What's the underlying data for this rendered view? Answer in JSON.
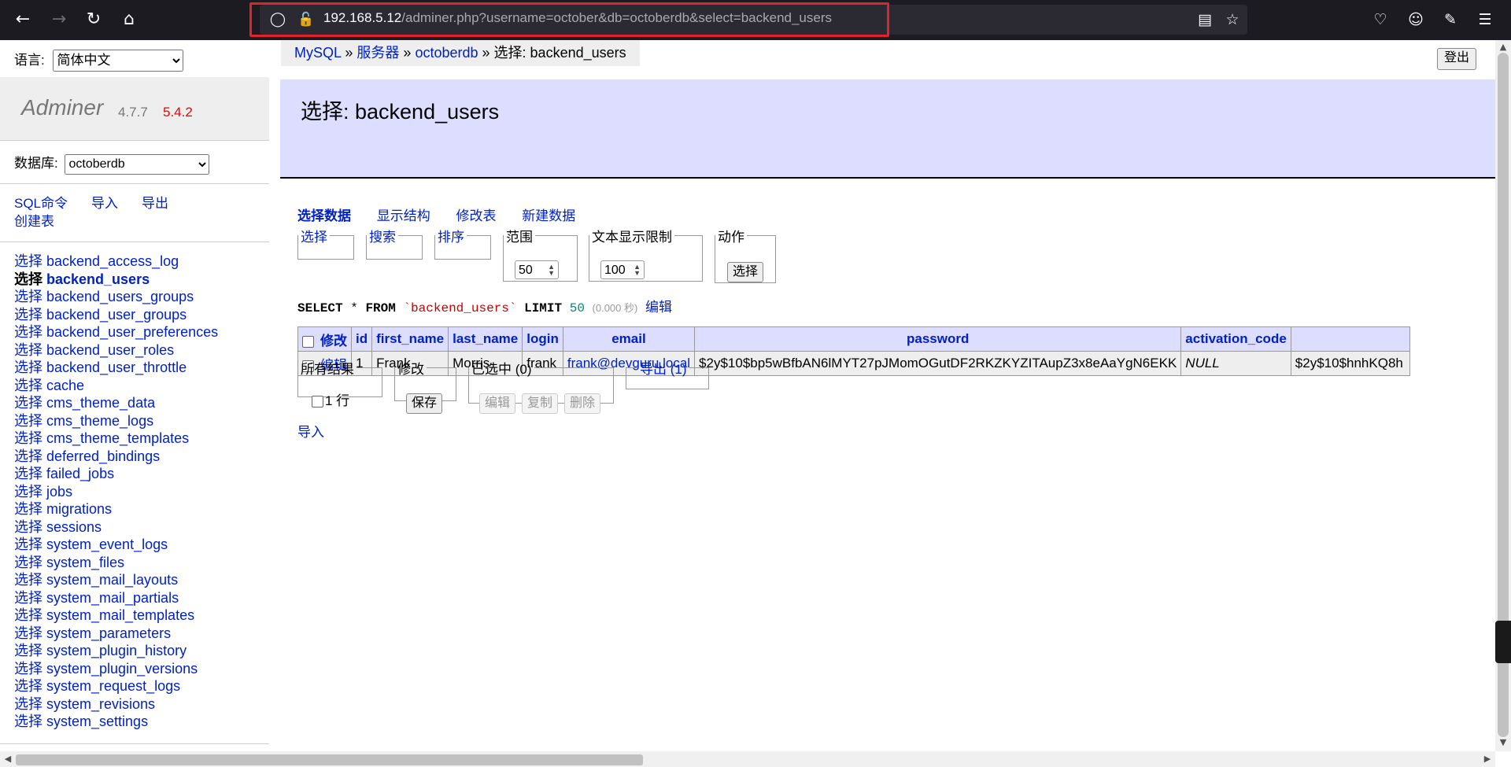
{
  "browser": {
    "url_host": "192.168.5.12",
    "url_path": "/adminer.php?username=october&db=octoberdb&select=backend_users",
    "icons": [
      "back-arrow-icon",
      "forward-arrow-icon",
      "reload-icon",
      "home-icon",
      "shield-icon",
      "lock-icon",
      "reader-view-icon",
      "bookmark-star-icon",
      "pocket-icon",
      "account-icon",
      "extensions-icon",
      "menu-icon"
    ]
  },
  "sidebar": {
    "language_label": "语言:",
    "language_value": "简体中文",
    "app_name": "Adminer",
    "app_version": "4.7.7",
    "new_version": "5.4.2",
    "db_label": "数据库:",
    "db_value": "octoberdb",
    "commands": {
      "sql": "SQL命令",
      "import": "导入",
      "export": "导出",
      "create_table": "创建表"
    },
    "select_prefix": "选择",
    "tables": [
      "backend_access_log",
      "backend_users",
      "backend_users_groups",
      "backend_user_groups",
      "backend_user_preferences",
      "backend_user_roles",
      "backend_user_throttle",
      "cache",
      "cms_theme_data",
      "cms_theme_logs",
      "cms_theme_templates",
      "deferred_bindings",
      "failed_jobs",
      "jobs",
      "migrations",
      "sessions",
      "system_event_logs",
      "system_files",
      "system_mail_layouts",
      "system_mail_partials",
      "system_mail_templates",
      "system_parameters",
      "system_plugin_history",
      "system_plugin_versions",
      "system_request_logs",
      "system_revisions",
      "system_settings"
    ],
    "current_table_index": 1
  },
  "breadcrumb": {
    "mysql": "MySQL",
    "sep": "»",
    "server": "服务器",
    "db": "octoberdb",
    "current": "选择: backend_users"
  },
  "logout_label": "登出",
  "page_title": "选择: backend_users",
  "actions": [
    "选择数据",
    "显示结构",
    "修改表",
    "新建数据"
  ],
  "form": {
    "select_legend": "选择",
    "search_legend": "搜索",
    "sort_legend": "排序",
    "limit_legend": "范围",
    "limit_value": "50",
    "text_limit_legend": "文本显示限制",
    "text_limit_value": "100",
    "action_legend": "动作",
    "action_button": "选择"
  },
  "sql": {
    "select": "SELECT",
    "star": "*",
    "from": "FROM",
    "table": "`backend_users`",
    "limit": "LIMIT",
    "limit_num": "50",
    "time": "(0.000 秒)",
    "edit": "编辑"
  },
  "table": {
    "modify_header": "修改",
    "columns": [
      "id",
      "first_name",
      "last_name",
      "login",
      "email",
      "password",
      "activation_code",
      ""
    ],
    "rows": [
      {
        "edit": "编辑",
        "cells": [
          "1",
          "Frank",
          "Morris",
          "frank",
          "frank@devguru.local",
          "$2y$10$bp5wBfbAN6lMYT27pJMomOGutDF2RKZKYZITAupZ3x8eAaYgN6EKK",
          "NULL",
          "$2y$10$hnhKQ8h"
        ]
      }
    ]
  },
  "footer": {
    "all_results_legend": "所有结果",
    "rows_label": "1 行",
    "modify_legend": "修改",
    "save_button": "保存",
    "selected_legend": "已选中 (0)",
    "edit_button": "编辑",
    "copy_button": "复制",
    "delete_button": "删除",
    "export_legend": "导出 (1)",
    "import_link": "导入"
  },
  "colors": {
    "link": "#0021c8",
    "header_bg": "#ddf",
    "highlight": "#e0242c",
    "new_version": "#e00"
  }
}
